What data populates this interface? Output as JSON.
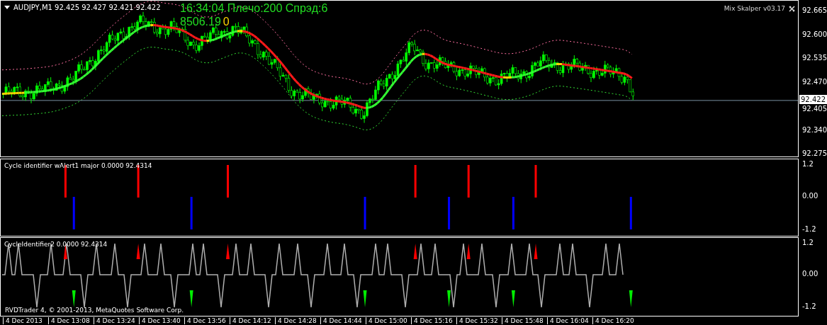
{
  "main_pane": {
    "symbol_line": "AUDJPY,M1  92.425 92.427 92.421 92.422",
    "clock_line": "16:34:04 Плечо:200 Спрэд:6",
    "balance": "8506.19",
    "balance_suffix": "0",
    "indicator_label": "Mix Skalper v03.17",
    "current_price": "92.422",
    "price_axis": [
      "92.665",
      "92.600",
      "92.535",
      "92.470",
      "92.405",
      "92.340",
      "92.275"
    ]
  },
  "cycle_pane": {
    "title": "Cycle identifier wAlert1 major 0.0000 92.4314",
    "axis": [
      "1.2",
      "0.00",
      "-1.2"
    ]
  },
  "cycle2_pane": {
    "title": "CycleIdentifier2 0.0000 92.4314",
    "axis": [
      "1.2",
      "0.00",
      "-1.2"
    ],
    "copyright": "RVDTrader 4, © 2001-2013, MetaQuotes Software Corp."
  },
  "time_axis": [
    "4 Dec 2013",
    "4 Dec 13:08",
    "4 Dec 13:24",
    "4 Dec 13:40",
    "4 Dec 13:56",
    "4 Dec 14:12",
    "4 Dec 14:28",
    "4 Dec 14:44",
    "4 Dec 15:00",
    "4 Dec 15:16",
    "4 Dec 15:32",
    "4 Dec 15:48",
    "4 Dec 16:04",
    "4 Dec 16:20"
  ]
}
